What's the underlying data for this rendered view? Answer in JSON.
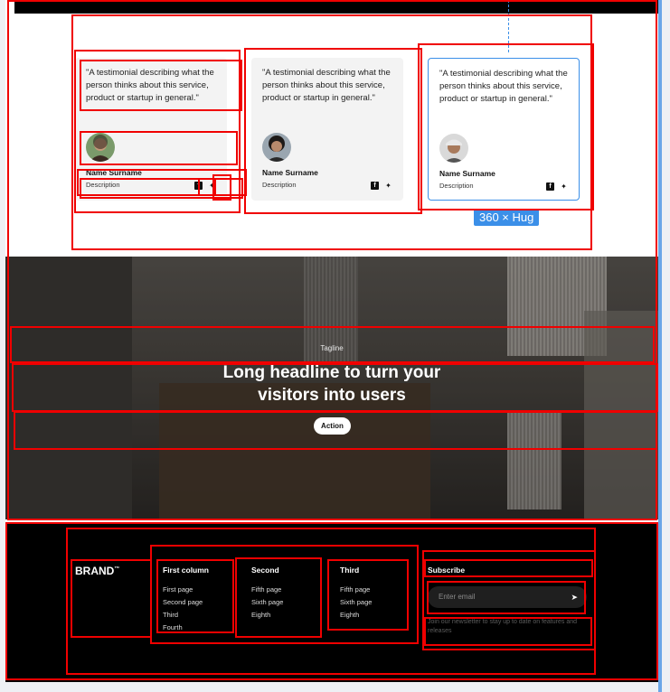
{
  "testimonials": [
    {
      "quote": "\"A testimonial describing what the person thinks about this service, product or startup in general.\"",
      "name": "Name Surname",
      "description": "Description"
    },
    {
      "quote": "\"A testimonial describing what the person thinks about this service, product or startup in general.\"",
      "name": "Name Surname",
      "description": "Description"
    },
    {
      "quote": "\"A testimonial describing what the person thinks about this service, product or startup in general.\"",
      "name": "Name Surname",
      "description": "Description"
    }
  ],
  "size_badge": "360 × Hug",
  "hero": {
    "tagline": "Tagline",
    "headline_line1": "Long headline to turn your",
    "headline_line2": "visitors into users",
    "action_label": "Action"
  },
  "footer": {
    "brand": "BRAND",
    "brand_mark": "™",
    "columns": [
      {
        "title": "First column",
        "items": [
          "First page",
          "Second page",
          "Third",
          "Fourth"
        ]
      },
      {
        "title": "Second",
        "items": [
          "Fifth page",
          "Sixth page",
          "Eighth"
        ]
      },
      {
        "title": "Third",
        "items": [
          "Fifth page",
          "Sixth page",
          "Eighth"
        ]
      }
    ],
    "subscribe": {
      "title": "Subscribe",
      "placeholder": "Enter email",
      "note": "Join our newsletter to stay up to date on features and releases"
    }
  }
}
